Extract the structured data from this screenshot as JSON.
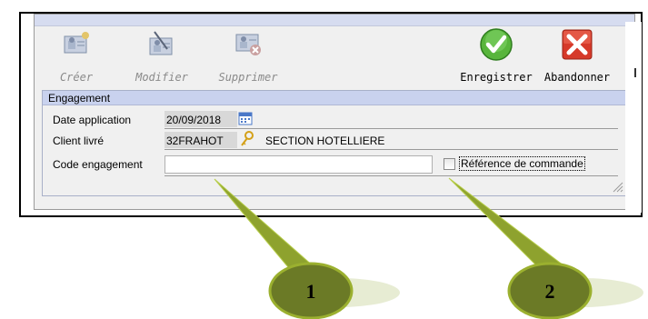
{
  "toolbar": {
    "buttons": [
      {
        "label": "Créer",
        "icon": "create-user-icon",
        "enabled": false
      },
      {
        "label": "Modifier",
        "icon": "edit-user-icon",
        "enabled": false
      },
      {
        "label": "Supprimer",
        "icon": "delete-user-icon",
        "enabled": false
      },
      {
        "label": "Enregistrer",
        "icon": "green-check-icon",
        "enabled": true
      },
      {
        "label": "Abandonner",
        "icon": "red-cross-icon",
        "enabled": true
      }
    ]
  },
  "engagement": {
    "title": "Engagement",
    "date_label": "Date application",
    "date_value": "20/09/2018",
    "client_label": "Client livré",
    "client_code": "32FRAHOT",
    "client_name": "SECTION HOTELLIERE",
    "code_label": "Code engagement",
    "code_value": "",
    "reference_label": "Référence de commande",
    "reference_checked": false
  },
  "callouts": [
    {
      "number": "1",
      "points_to": "code-engagement-input"
    },
    {
      "number": "2",
      "points_to": "reference-commande-checkbox"
    }
  ],
  "colors": {
    "callout_fill": "#6b7a26",
    "callout_stroke": "#9bb02f",
    "group_header": "#c9d2ee",
    "window_top": "#d6dcf0"
  }
}
